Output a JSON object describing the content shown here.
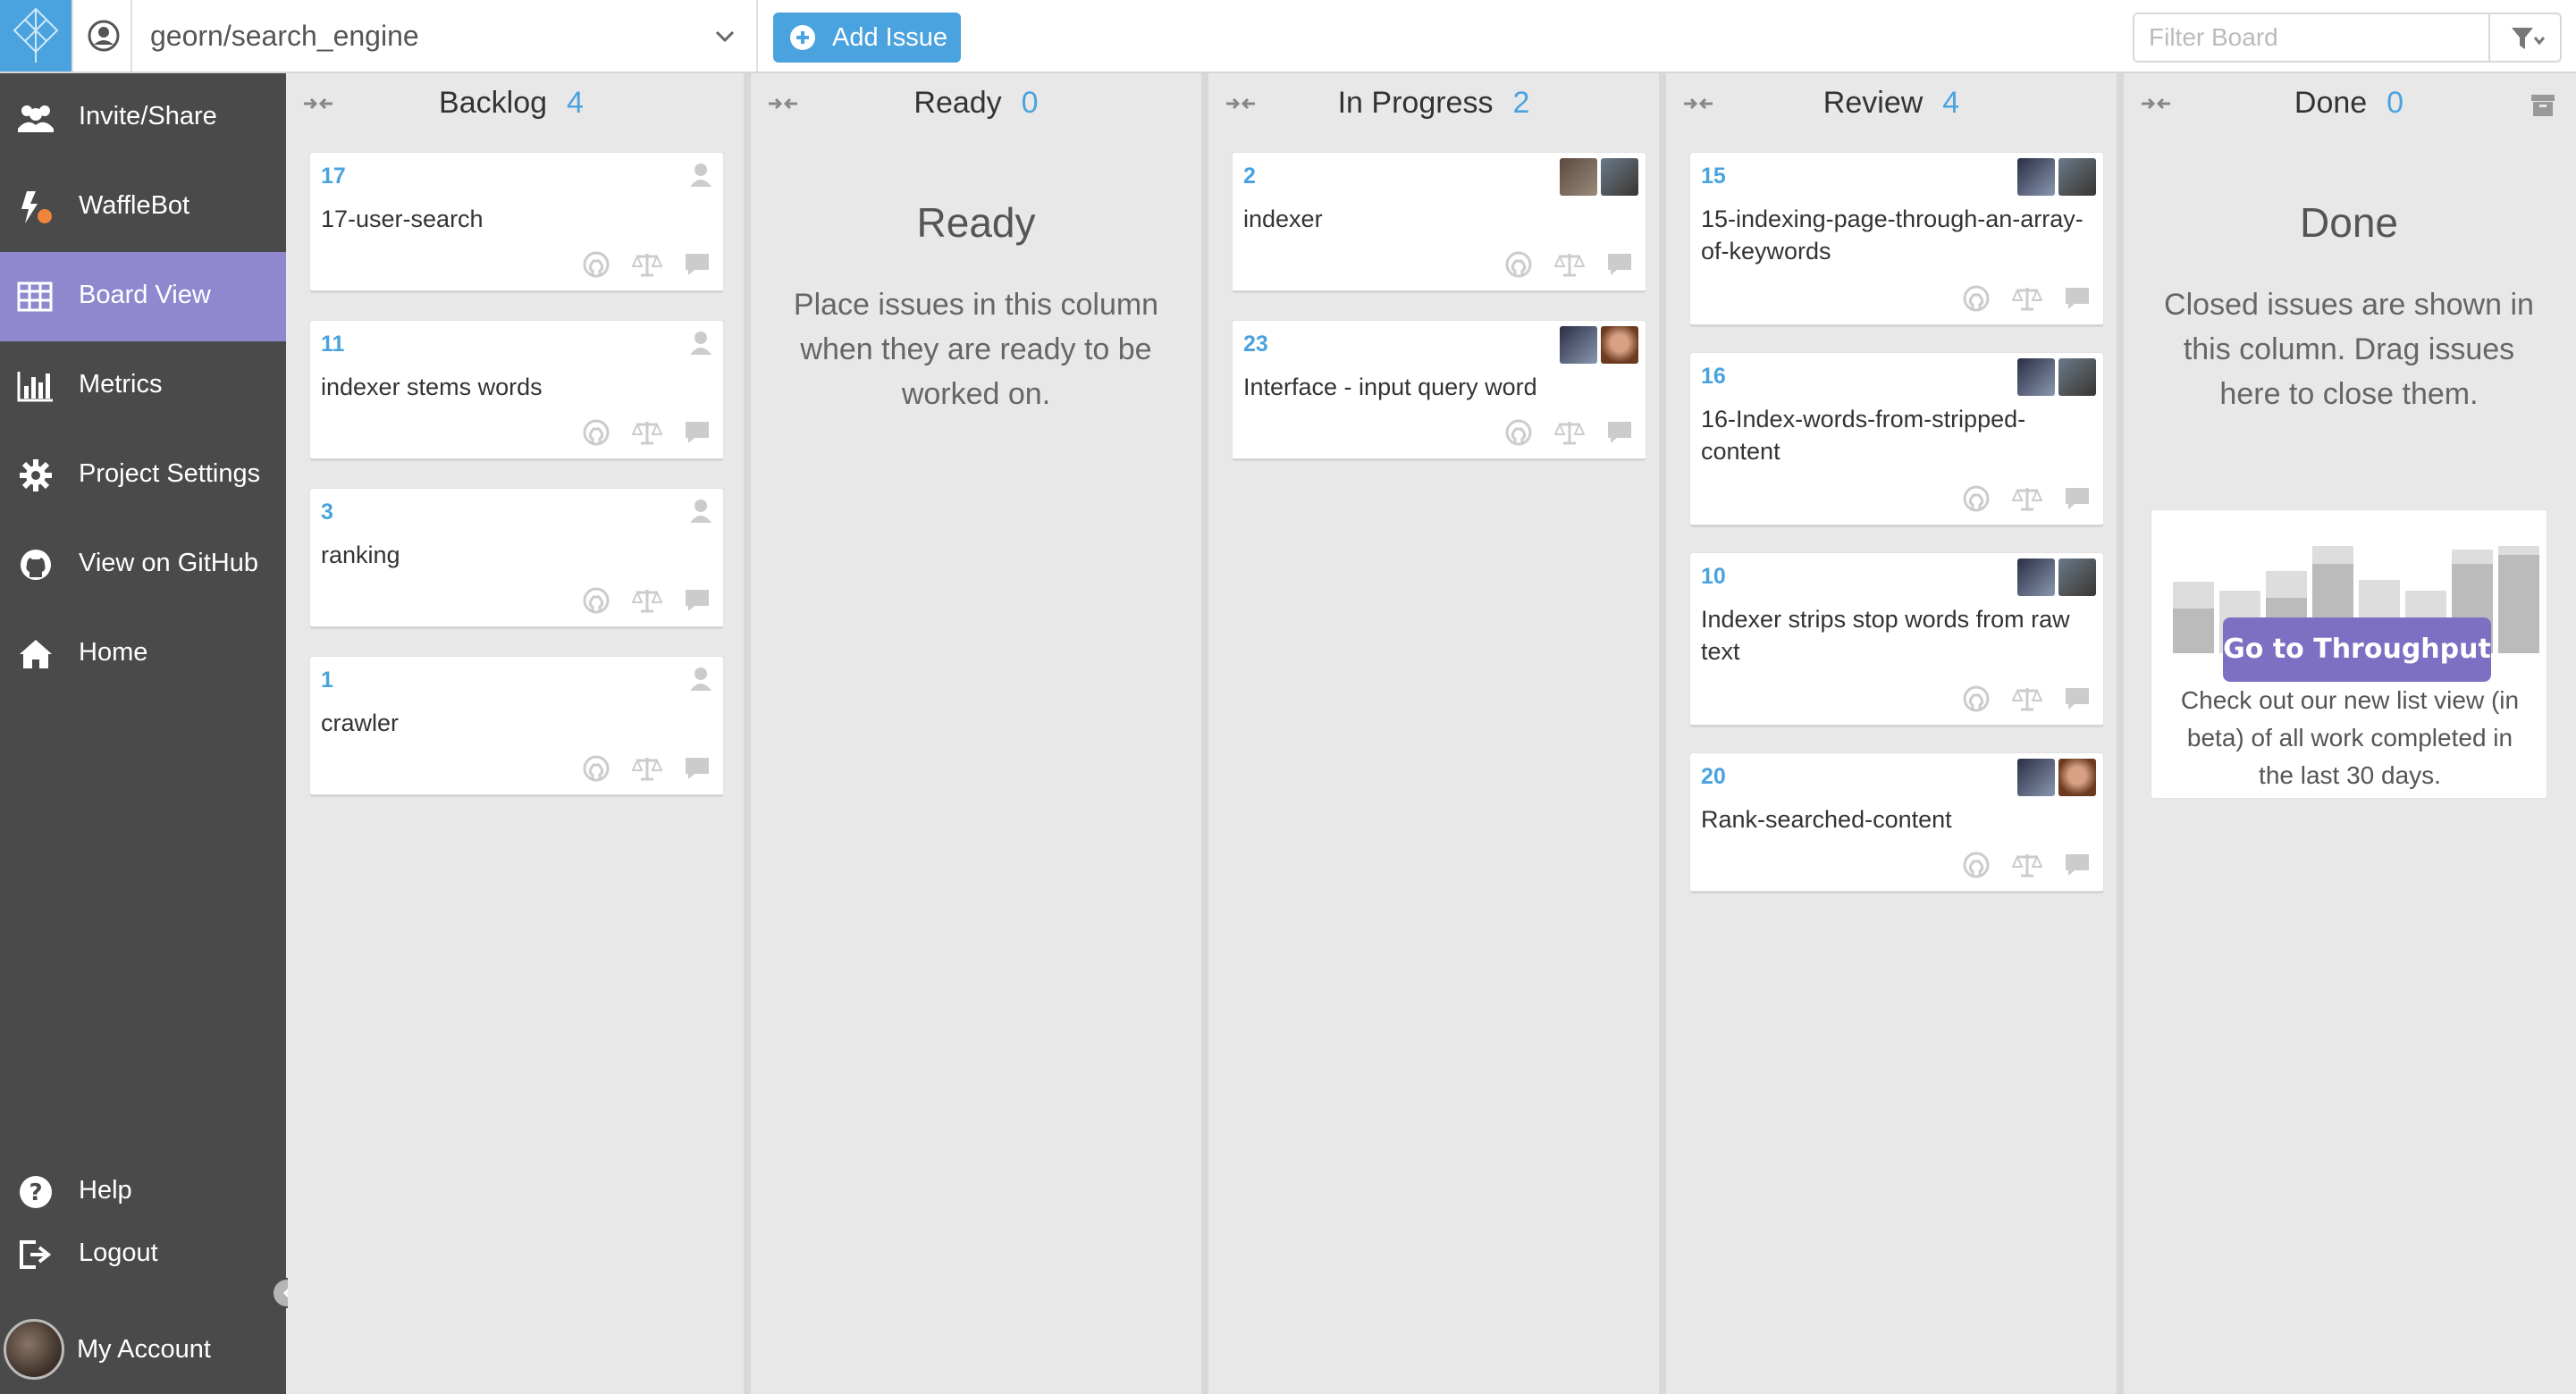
{
  "topbar": {
    "project_name": "georn/search_engine",
    "add_issue_label": "Add Issue",
    "filter_placeholder": "Filter Board"
  },
  "sidebar": {
    "items": [
      {
        "label": "Invite/Share",
        "icon": "users-icon"
      },
      {
        "label": "WaffleBot",
        "icon": "bolt-icon"
      },
      {
        "label": "Board View",
        "icon": "table-icon",
        "active": true
      },
      {
        "label": "Metrics",
        "icon": "bar-chart-icon"
      },
      {
        "label": "Project Settings",
        "icon": "gear-icon"
      },
      {
        "label": "View on GitHub",
        "icon": "github-icon"
      },
      {
        "label": "Home",
        "icon": "home-icon"
      }
    ],
    "bottom": [
      {
        "label": "Help",
        "icon": "help-icon"
      },
      {
        "label": "Logout",
        "icon": "logout-icon"
      }
    ],
    "account_label": "My Account"
  },
  "columns": [
    {
      "name": "Backlog",
      "count": "4",
      "cards": [
        {
          "number": "17",
          "title": "17-user-search"
        },
        {
          "number": "11",
          "title": "indexer stems words"
        },
        {
          "number": "3",
          "title": "ranking"
        },
        {
          "number": "1",
          "title": "crawler"
        }
      ]
    },
    {
      "name": "Ready",
      "count": "0",
      "placeholder_title": "Ready",
      "placeholder_body": "Place issues in this column when they are ready to be worked on."
    },
    {
      "name": "In Progress",
      "count": "2",
      "cards": [
        {
          "number": "2",
          "title": "indexer"
        },
        {
          "number": "23",
          "title": "Interface - input query word"
        }
      ]
    },
    {
      "name": "Review",
      "count": "4",
      "cards": [
        {
          "number": "15",
          "title": "15-indexing-page-through-an-array-of-keywords"
        },
        {
          "number": "16",
          "title": "16-Index-words-from-stripped-content"
        },
        {
          "number": "10",
          "title": "Indexer strips stop words from raw text"
        },
        {
          "number": "20",
          "title": "Rank-searched-content"
        }
      ]
    },
    {
      "name": "Done",
      "count": "0",
      "placeholder_title": "Done",
      "placeholder_body": "Closed issues are shown in this column. Drag issues here to close them.",
      "promo": {
        "button_label": "Go to Throughput",
        "text": "Check out our new list view (in beta) of all work completed in the last 30 days."
      }
    }
  ],
  "colors": {
    "accent": "#4aa3df",
    "sidebar_bg": "#4a4a4a",
    "sidebar_active": "#8f88cf",
    "promo_button": "#7d6fc2"
  }
}
